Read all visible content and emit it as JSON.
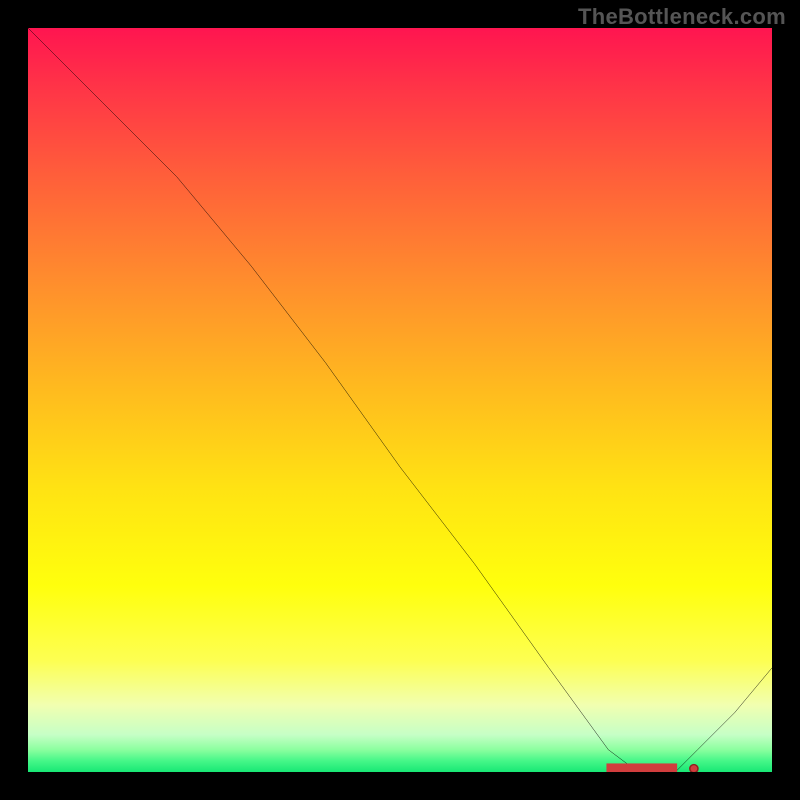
{
  "watermark": "TheBottleneck.com",
  "chart_data": {
    "type": "line",
    "title": "",
    "xlabel": "",
    "ylabel": "",
    "xlim": [
      0,
      100
    ],
    "ylim": [
      0,
      100
    ],
    "gradient_stops": [
      {
        "pct": 0,
        "color": "#ff1550"
      },
      {
        "pct": 8,
        "color": "#ff3447"
      },
      {
        "pct": 20,
        "color": "#ff5f3a"
      },
      {
        "pct": 34,
        "color": "#ff8d2d"
      },
      {
        "pct": 48,
        "color": "#ffb91f"
      },
      {
        "pct": 62,
        "color": "#ffe313"
      },
      {
        "pct": 75,
        "color": "#ffff0d"
      },
      {
        "pct": 85,
        "color": "#fdff52"
      },
      {
        "pct": 91,
        "color": "#f1ffb0"
      },
      {
        "pct": 95,
        "color": "#c6ffc6"
      },
      {
        "pct": 97,
        "color": "#8bff9f"
      },
      {
        "pct": 98.5,
        "color": "#46f788"
      },
      {
        "pct": 100,
        "color": "#18e875"
      }
    ],
    "series": [
      {
        "name": "bottleneck-curve",
        "x": [
          0,
          10,
          20,
          25,
          30,
          40,
          50,
          60,
          70,
          78,
          82,
          87,
          90,
          95,
          100
        ],
        "y": [
          100,
          90,
          80,
          74,
          68,
          55,
          41,
          28,
          14,
          3,
          0,
          0,
          3,
          8,
          14
        ]
      }
    ],
    "scatter": {
      "name": "highlight-range",
      "x": [
        78,
        79,
        80,
        81,
        82,
        83,
        84,
        85,
        86,
        87,
        89.5
      ],
      "y": [
        0,
        0,
        0,
        0,
        0,
        0,
        0,
        0,
        0,
        0,
        0
      ]
    }
  }
}
